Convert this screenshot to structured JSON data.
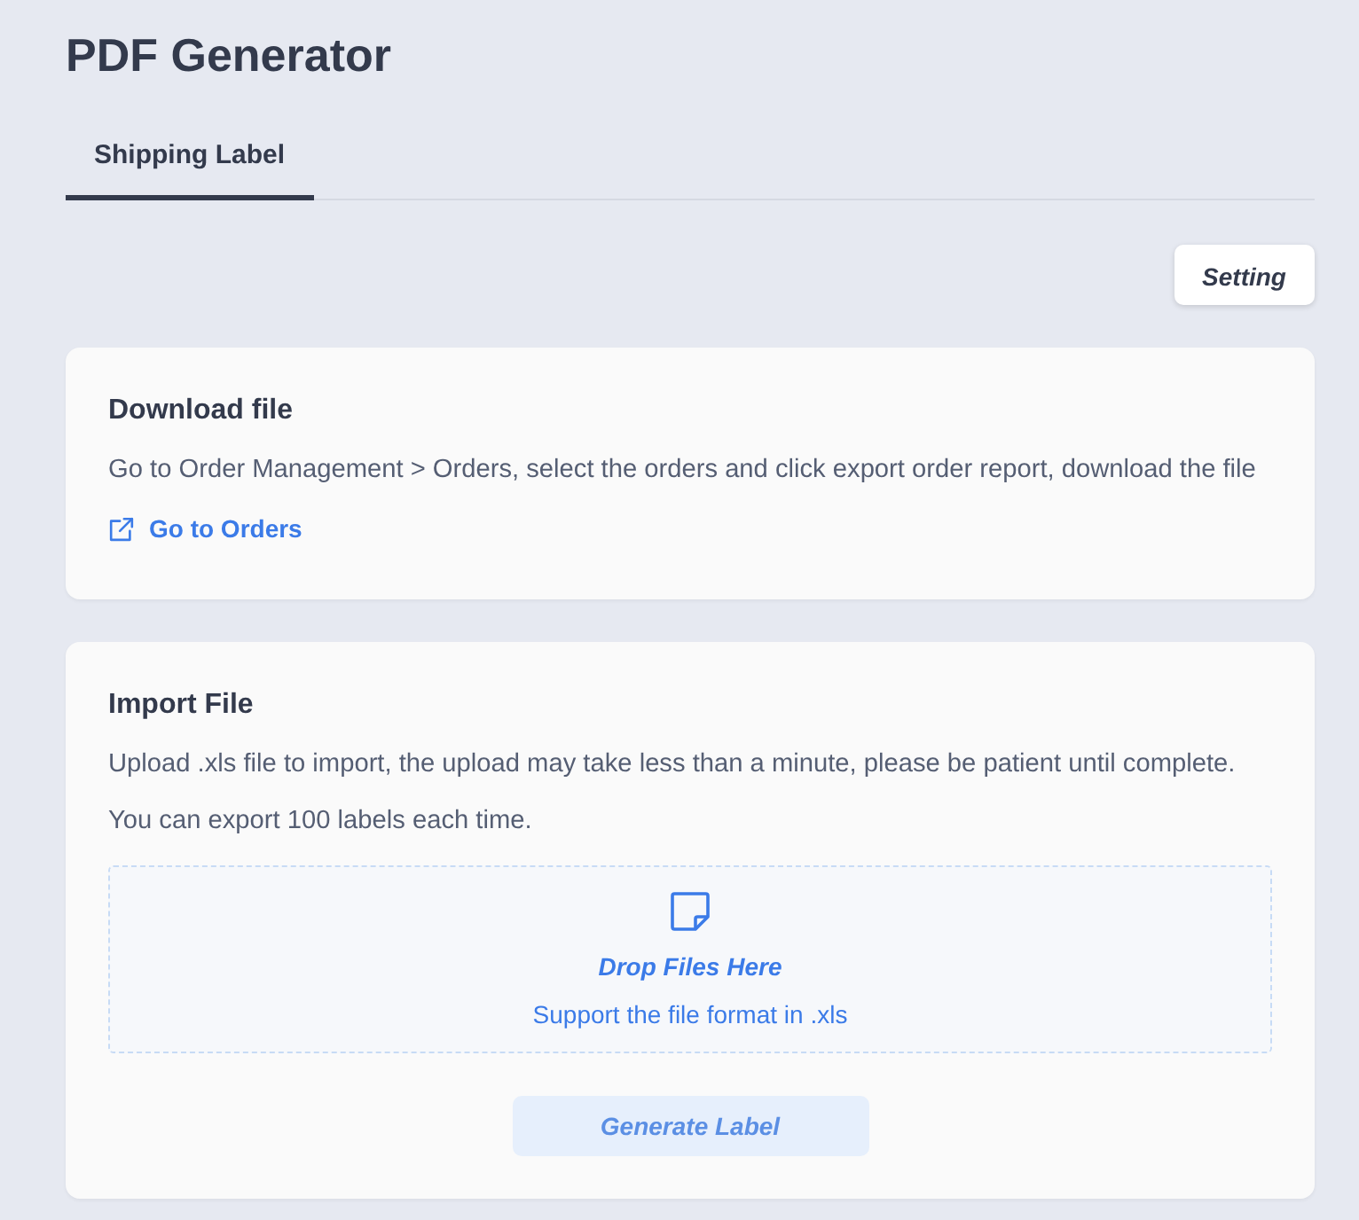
{
  "title": "PDF Generator",
  "tabs": [
    {
      "label": "Shipping Label",
      "selected": true
    }
  ],
  "toolbar": {
    "setting_button": "Setting"
  },
  "download_card": {
    "title": "Download file",
    "description": "Go to Order Management > Orders, select the orders and click export order report, download the file",
    "link": "Go to Orders"
  },
  "import_card": {
    "title": "Import File",
    "notes": [
      "Upload .xls file to import, the upload may take less than a minute, please be patient until complete.",
      "You can export 100 labels each time."
    ],
    "dropzone": {
      "title": "Drop Files Here",
      "hint": "Support the file format in .xls"
    },
    "generate_button": {
      "label": "Generate Label",
      "disabled": true
    }
  }
}
